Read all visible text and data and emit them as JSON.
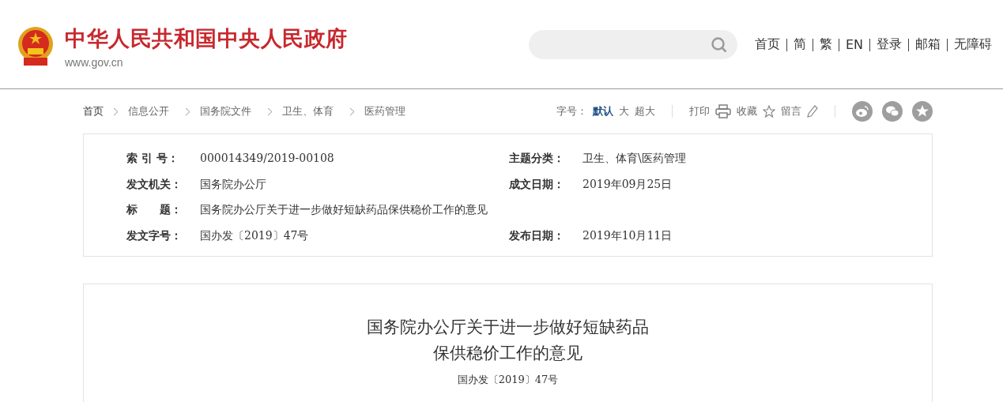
{
  "header": {
    "site_name": "中华人民共和国中央人民政府",
    "site_url": "www.gov.cn",
    "nav": [
      {
        "label": "首页"
      },
      {
        "label": "简"
      },
      {
        "label": "繁"
      },
      {
        "label": "EN"
      },
      {
        "label": "登录"
      },
      {
        "label": "邮箱"
      },
      {
        "label": "无障碍"
      }
    ]
  },
  "breadcrumb": [
    {
      "label": "首页",
      "kind": "home"
    },
    {
      "label": "信息公开",
      "kind": "link"
    },
    {
      "label": "国务院文件",
      "kind": "link"
    },
    {
      "label": "卫生、体育",
      "kind": "link"
    },
    {
      "label": "医药管理",
      "kind": "link"
    }
  ],
  "font_size": {
    "label": "字号：",
    "options": [
      {
        "label": "默认",
        "selected": true
      },
      {
        "label": "大",
        "selected": false
      },
      {
        "label": "超大",
        "selected": false
      }
    ]
  },
  "tools": [
    {
      "label": "打印",
      "kind": "print"
    },
    {
      "label": "收藏",
      "kind": "favorite"
    },
    {
      "label": "留言",
      "kind": "comment"
    }
  ],
  "share": [
    {
      "kind": "weibo"
    },
    {
      "kind": "wechat"
    },
    {
      "kind": "favorite"
    }
  ],
  "meta": [
    {
      "label": "索 引 号：",
      "value": "000014349/2019-00108",
      "label_2": "主题分类：",
      "value_2": "卫生、体育\\医药管理"
    },
    {
      "label": "发文机关：",
      "value": "国务院办公厅",
      "label_2": "成文日期：",
      "value_2": "2019年09月25日"
    },
    {
      "label": "标　　题：",
      "value": "国务院办公厅关于进一步做好短缺药品保供稳价工作的意见"
    },
    {
      "label": "发文字号：",
      "value": "国办发〔2019〕47号",
      "label_2": "发布日期：",
      "value_2": "2019年10月11日"
    }
  ],
  "article": {
    "title_lines": [
      "国务院办公厅关于进一步做好短缺药品",
      "保供稳价工作的意见"
    ],
    "doc_number": "国办发〔2019〕47号"
  }
}
